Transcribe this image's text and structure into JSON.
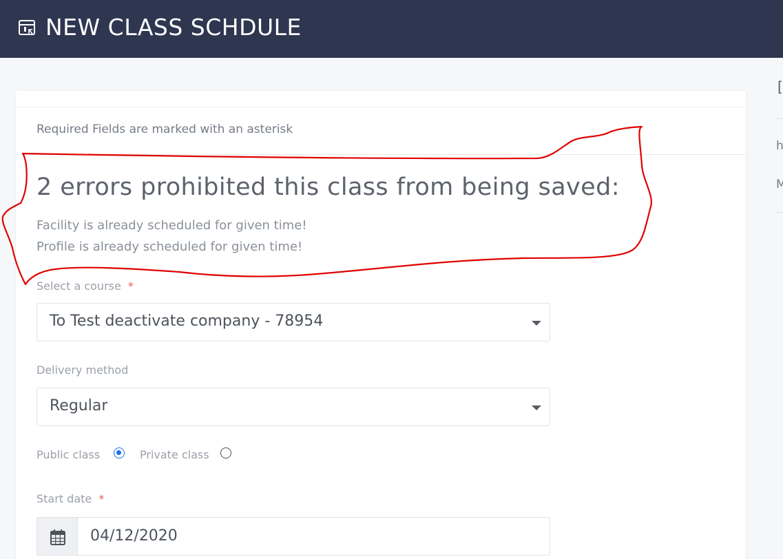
{
  "header": {
    "title": "NEW CLASS SCHDULE",
    "icon": "schedule-note-icon",
    "bg_color": "#2e3650"
  },
  "form": {
    "required_note": "Required Fields are marked with an asterisk",
    "errors": {
      "title": "2 errors prohibited this class from being saved:",
      "messages": [
        "Facility is already scheduled for given time!",
        "Profile is already scheduled for given time!"
      ]
    },
    "course": {
      "label": "Select a course",
      "required_mark": "*",
      "value": "To Test deactivate company - 78954"
    },
    "delivery": {
      "label": "Delivery method",
      "value": "Regular"
    },
    "visibility": {
      "public_label": "Public class",
      "private_label": "Private class",
      "selected": "public"
    },
    "start_date": {
      "label": "Start date",
      "required_mark": "*",
      "value": "04/12/2020",
      "icon": "calendar-icon"
    }
  },
  "side": {
    "glyph_top": "[",
    "glyph_mid": "h",
    "glyph_bottom": "M"
  },
  "colors": {
    "annotation": "#e00000",
    "required_mark": "#e0624d",
    "radio_selected": "#1a73e8"
  }
}
